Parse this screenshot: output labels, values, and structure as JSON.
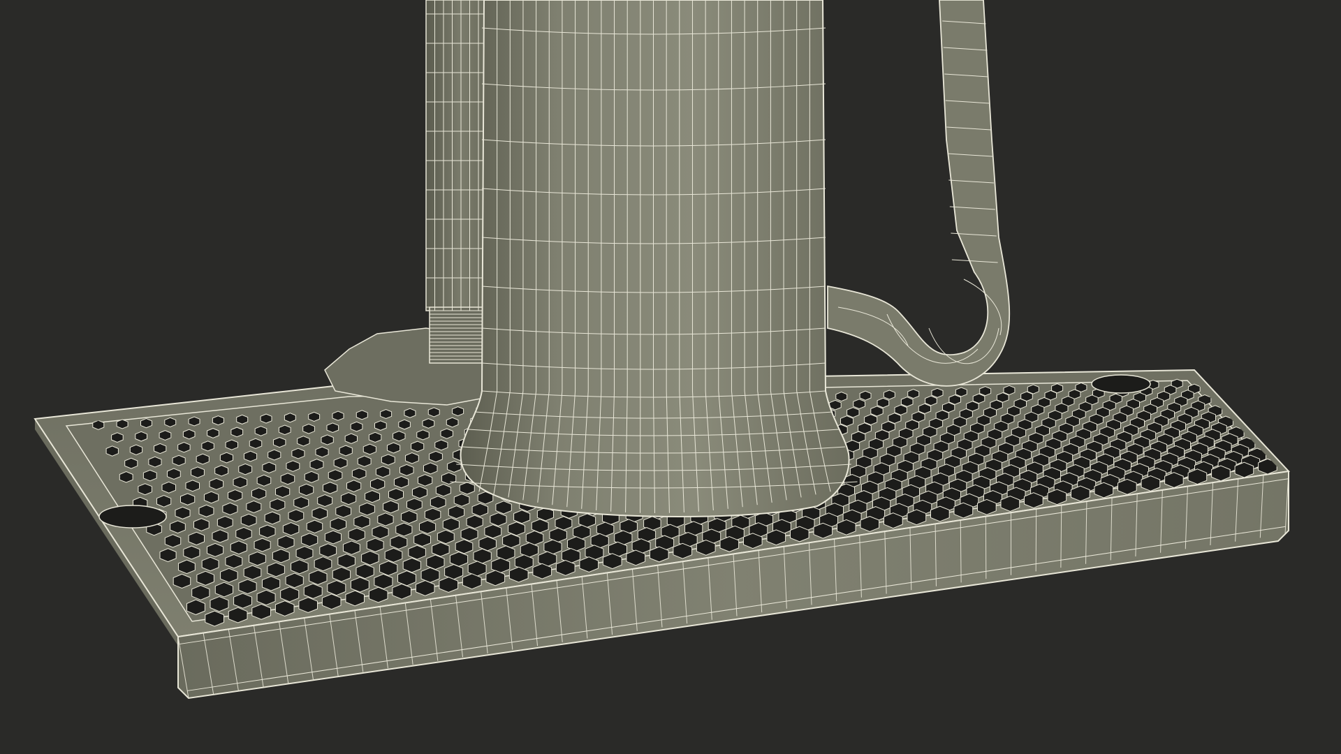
{
  "scene": {
    "subject": "wireframe-render",
    "colors": {
      "background": "#2a2a28",
      "surface": "#7b7c6c",
      "surface_light": "#8a8b79",
      "surface_dark": "#616253",
      "wire": "#e9e7d8",
      "hole": "#1c1c1a",
      "shadow": "#3a3a35"
    },
    "elements": [
      "drip-tray",
      "perforated-grate",
      "beer-mug",
      "mug-handle",
      "tap-tower",
      "tower-flange"
    ]
  }
}
